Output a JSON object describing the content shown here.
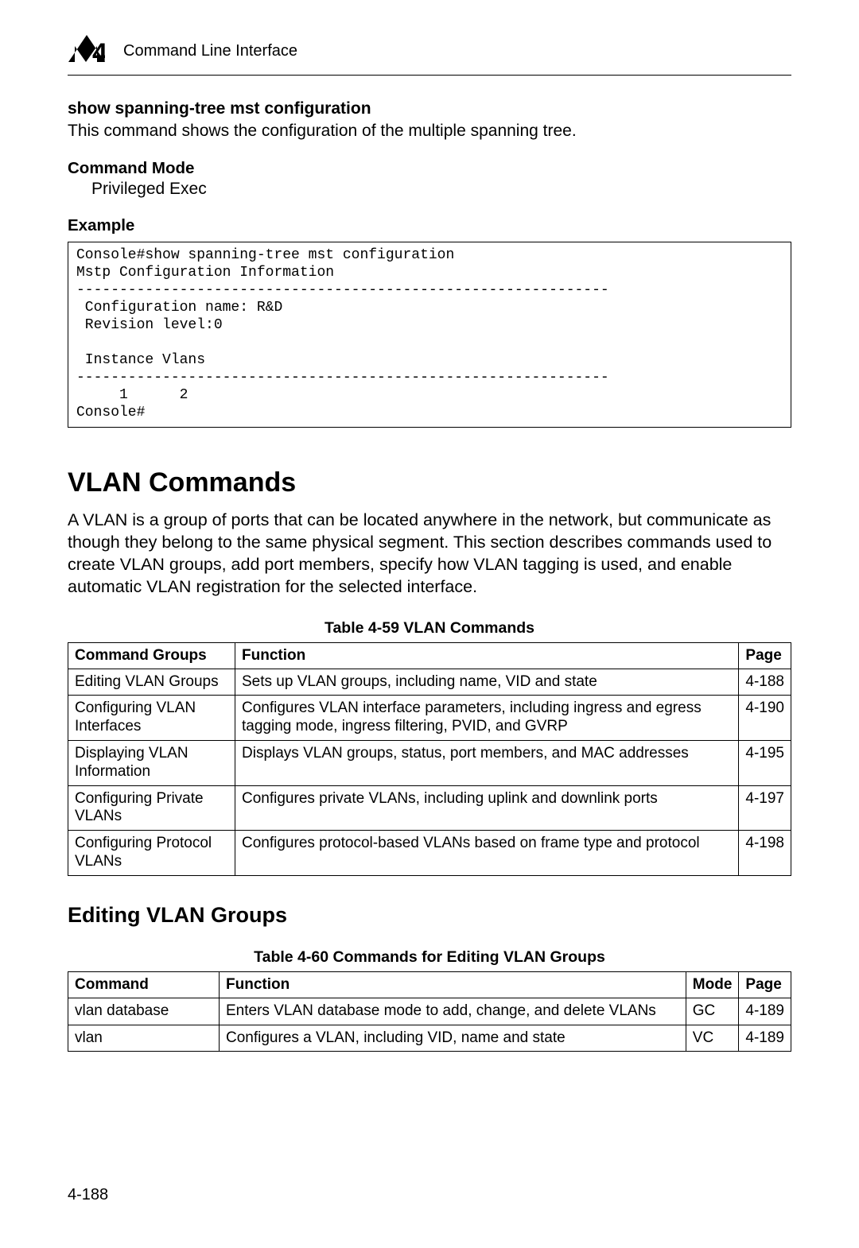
{
  "header": {
    "chapter_number": "4",
    "title": "Command Line Interface"
  },
  "section1": {
    "heading": "show spanning-tree mst configuration",
    "desc": "This command shows the configuration of the multiple spanning tree.",
    "mode_label": "Command Mode",
    "mode_value": "Privileged Exec",
    "example_label": "Example",
    "code": "Console#show spanning-tree mst configuration\nMstp Configuration Information\n--------------------------------------------------------------\n Configuration name: R&D\n Revision level:0\n\n Instance Vlans\n--------------------------------------------------------------\n     1      2\nConsole#"
  },
  "vlan": {
    "title": "VLAN Commands",
    "intro": "A VLAN is a group of ports that can be located anywhere in the network, but communicate as though they belong to the same physical segment. This section describes commands used to create VLAN groups, add port members, specify how VLAN tagging is used, and enable automatic VLAN registration for the selected interface.",
    "table1": {
      "caption": "Table 4-59   VLAN Commands",
      "headers": {
        "c1": "Command Groups",
        "c2": "Function",
        "c3": "Page"
      },
      "rows": [
        {
          "c1": "Editing VLAN Groups",
          "c2": "Sets up VLAN groups, including name, VID and state",
          "c3": "4-188"
        },
        {
          "c1": "Configuring VLAN Interfaces",
          "c2": "Configures VLAN interface parameters, including ingress and egress tagging mode, ingress filtering, PVID, and GVRP",
          "c3": "4-190"
        },
        {
          "c1": "Displaying VLAN Information",
          "c2": "Displays VLAN groups, status, port members, and MAC addresses",
          "c3": "4-195"
        },
        {
          "c1": "Configuring Private VLANs",
          "c2": "Configures private VLANs, including uplink and downlink ports",
          "c3": "4-197"
        },
        {
          "c1": "Configuring Protocol VLANs",
          "c2": "Configures protocol-based VLANs based on frame type and protocol",
          "c3": "4-198"
        }
      ]
    },
    "subheading": "Editing VLAN Groups",
    "table2": {
      "caption": "Table 4-60   Commands for Editing VLAN Groups",
      "headers": {
        "c1": "Command",
        "c2": "Function",
        "c3": "Mode",
        "c4": "Page"
      },
      "rows": [
        {
          "c1": "vlan database",
          "c2": "Enters VLAN database mode to add, change, and delete VLANs",
          "c3": "GC",
          "c4": "4-189"
        },
        {
          "c1": "vlan",
          "c2": "Configures a VLAN, including VID, name and state",
          "c3": "VC",
          "c4": "4-189"
        }
      ]
    }
  },
  "footer": {
    "page_number": "4-188"
  }
}
